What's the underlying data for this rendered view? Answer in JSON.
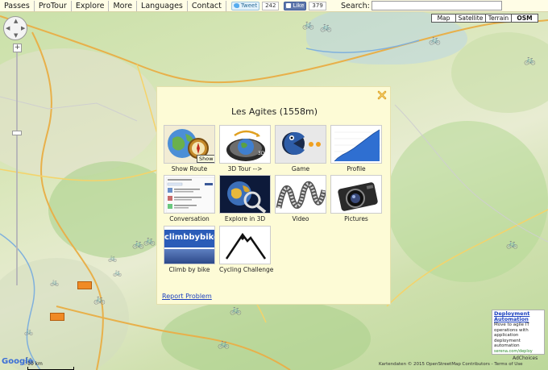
{
  "menu": {
    "items": [
      "Passes",
      "ProTour",
      "Explore",
      "More",
      "Languages",
      "Contact"
    ]
  },
  "share": {
    "tweet_label": "Tweet",
    "tweet_count": "242",
    "like_label": "Like",
    "like_count": "379"
  },
  "search": {
    "label": "Search:",
    "value": ""
  },
  "map_types": [
    "Map",
    "Satellite",
    "Terrain",
    "OSM"
  ],
  "map_type_active": "OSM",
  "modal": {
    "title": "Les Agites (1558m)",
    "tiles": [
      {
        "caption": "Show Route",
        "icon": "globe-compass"
      },
      {
        "caption": "3D Tour -->",
        "icon": "earth-3d"
      },
      {
        "caption": "Game",
        "icon": "pacman"
      },
      {
        "caption": "Profile",
        "icon": "elevation-profile"
      },
      {
        "caption": "Conversation",
        "icon": "comments"
      },
      {
        "caption": "Explore in 3D",
        "icon": "globe-magnifier"
      },
      {
        "caption": "Video",
        "icon": "film-strip"
      },
      {
        "caption": "Pictures",
        "icon": "camera"
      },
      {
        "caption": "Climb by bike",
        "icon": "climbbybike-logo"
      },
      {
        "caption": "Cycling Challenge",
        "icon": "mountain"
      }
    ],
    "tooltip": "Show Route",
    "report_link": "Report Problem"
  },
  "logos": {
    "climbbybike": "climbbybike"
  },
  "ad": {
    "title": "Deployment Automation",
    "body": "Move to agile IT operations with application deployment automation",
    "url": "serena.com/deploy",
    "adchoices": "AdChoices"
  },
  "map": {
    "google": "Google",
    "scale": "10 km",
    "attribution": "Kartendaten © 2015 OpenStreetMap Contributors - Terms of Use"
  },
  "colors": {
    "modal_bg": "#fdfbd6",
    "topbar_bg": "#fffde6",
    "link": "#1a3fbf",
    "marker": "#f08a24"
  }
}
